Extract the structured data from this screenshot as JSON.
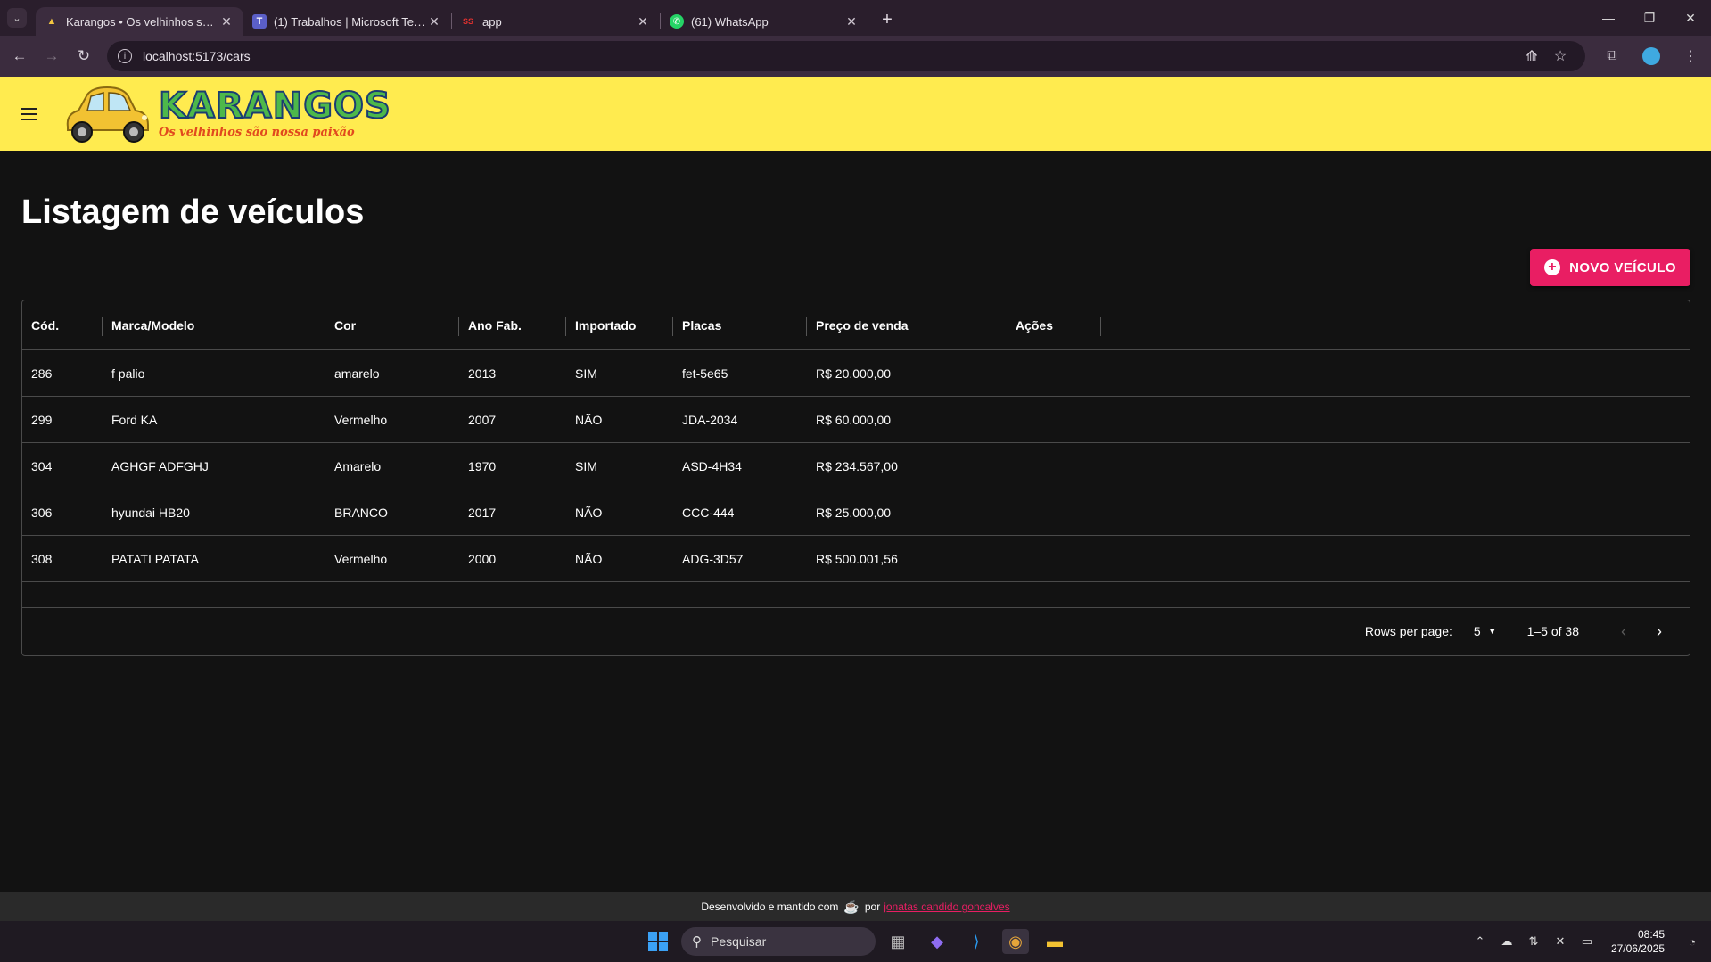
{
  "browser": {
    "tabs": [
      {
        "title": "Karangos • Os velhinhos são nossa paixão",
        "active": true,
        "icon": "car-favicon"
      },
      {
        "title": "(1) Trabalhos | Microsoft Teams",
        "active": false,
        "icon": "teams-favicon"
      },
      {
        "title": "app",
        "active": false,
        "icon": "app-favicon"
      },
      {
        "title": "(61) WhatsApp",
        "active": false,
        "icon": "whatsapp-favicon"
      }
    ],
    "url": "localhost:5173/cars"
  },
  "appbar": {
    "brand": "KARANGOS",
    "tagline": "Os velhinhos são nossa paixão",
    "background": "#ffeb4f"
  },
  "main": {
    "title": "Listagem de veículos",
    "new_button_label": "NOVO VEÍCULO",
    "accent": "#e91e63"
  },
  "table": {
    "columns": [
      "Cód.",
      "Marca/Modelo",
      "Cor",
      "Ano Fab.",
      "Importado",
      "Placas",
      "Preço de venda",
      "Ações"
    ],
    "rows": [
      [
        "286",
        "f palio",
        "amarelo",
        "2013",
        "SIM",
        "fet-5e65",
        "R$ 20.000,00"
      ],
      [
        "299",
        "Ford KA",
        "Vermelho",
        "2007",
        "NÃO",
        "JDA-2034",
        "R$ 60.000,00"
      ],
      [
        "304",
        "AGHGF ADFGHJ",
        "Amarelo",
        "1970",
        "SIM",
        "ASD-4H34",
        "R$ 234.567,00"
      ],
      [
        "306",
        "hyundai HB20",
        "BRANCO",
        "2017",
        "NÃO",
        "CCC-444",
        "R$ 25.000,00"
      ],
      [
        "308",
        "PATATI PATATA",
        "Vermelho",
        "2000",
        "NÃO",
        "ADG-3D57",
        "R$ 500.001,56"
      ]
    ],
    "pagination": {
      "rows_per_page_label": "Rows per page:",
      "rows_per_page": "5",
      "range": "1–5 of 38"
    }
  },
  "footer": {
    "text_before": "Desenvolvido e mantido com",
    "text_por": "por",
    "author": "jonatas candido goncalves"
  },
  "taskbar": {
    "search_placeholder": "Pesquisar",
    "time": "08:45",
    "date": "27/06/2025"
  }
}
